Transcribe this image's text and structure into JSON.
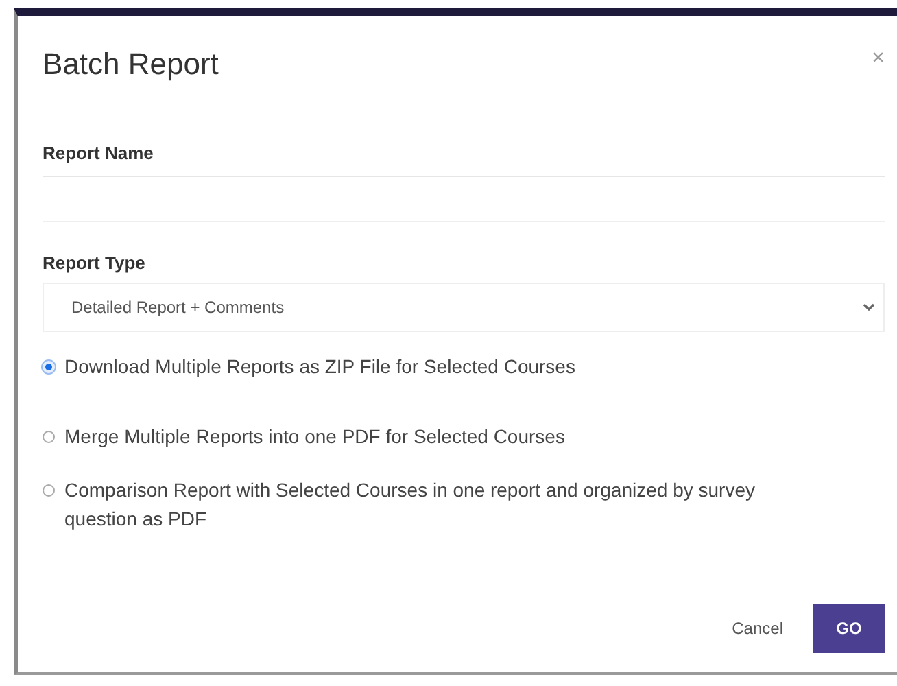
{
  "dialog": {
    "title": "Batch Report",
    "close": "×"
  },
  "report_name": {
    "label": "Report Name"
  },
  "report_type": {
    "label": "Report Type",
    "value": "Detailed Report + Comments"
  },
  "options": [
    {
      "label": "Download Multiple Reports as ZIP File for Selected Courses",
      "selected": true
    },
    {
      "label": "Merge Multiple Reports into one PDF for Selected Courses",
      "selected": false
    },
    {
      "label": "Comparison Report with Selected Courses in one report and organized by survey question as PDF",
      "selected": false
    }
  ],
  "buttons": [
    {
      "label": "Cancel",
      "kind": "link"
    },
    {
      "label": "GO",
      "kind": "primary"
    }
  ]
}
